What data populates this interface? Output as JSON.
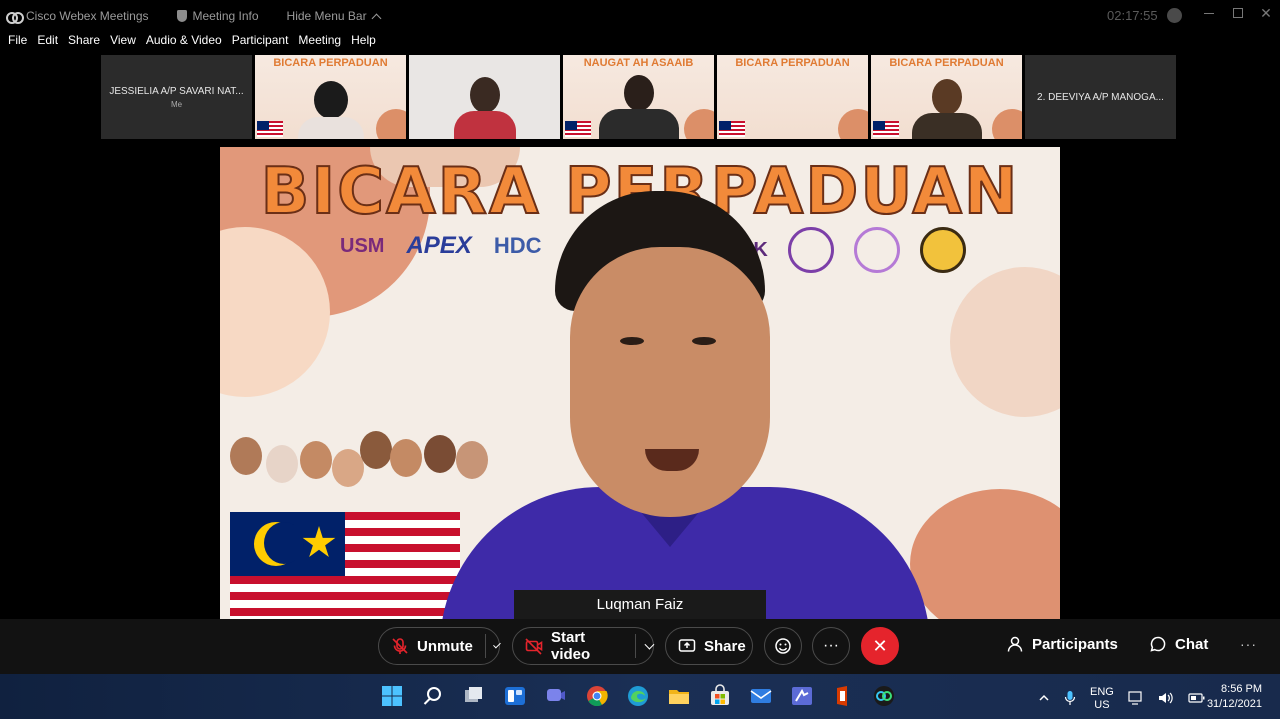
{
  "titlebar": {
    "app_name": "Cisco Webex Meetings",
    "meeting_info": "Meeting Info",
    "hide_menu": "Hide Menu Bar",
    "timer": "02:17:55"
  },
  "menu": [
    "File",
    "Edit",
    "Share",
    "View",
    "Audio & Video",
    "Participant",
    "Meeting",
    "Help"
  ],
  "thumbnails": [
    {
      "type": "name",
      "name": "JESSIELIA A/P SAVARI NAT...",
      "sub": "Me"
    },
    {
      "type": "poster",
      "title": "BICARA PERPADUAN"
    },
    {
      "type": "plain"
    },
    {
      "type": "poster",
      "title": "NAUGAT AH ASAAIB"
    },
    {
      "type": "poster",
      "title": "BICARA PERPADUAN"
    },
    {
      "type": "poster",
      "title": "BICARA PERPADUAN"
    },
    {
      "type": "name",
      "name": "2. DEEVIYA A/P MANOGA...",
      "sub": ""
    }
  ],
  "stage": {
    "banner_title": "BICARA PERPADUAN",
    "logos": {
      "usm": "USM",
      "apex": "APEX",
      "hdc": "HDC",
      "usm2": "USM",
      "ek": "EK"
    },
    "speaker_name": "Luqman Faiz"
  },
  "controls": {
    "unmute": "Unmute",
    "start_video": "Start video",
    "share": "Share",
    "more": "···",
    "participants": "Participants",
    "chat": "Chat",
    "overflow": "···"
  },
  "taskbar": {
    "lang_top": "ENG",
    "lang_bottom": "US",
    "time": "8:56 PM",
    "date": "31/12/2021"
  },
  "colors": {
    "end_call": "#e5242c",
    "banner_orange": "#f28a3a",
    "shirt_blue": "#3e2aa8"
  }
}
